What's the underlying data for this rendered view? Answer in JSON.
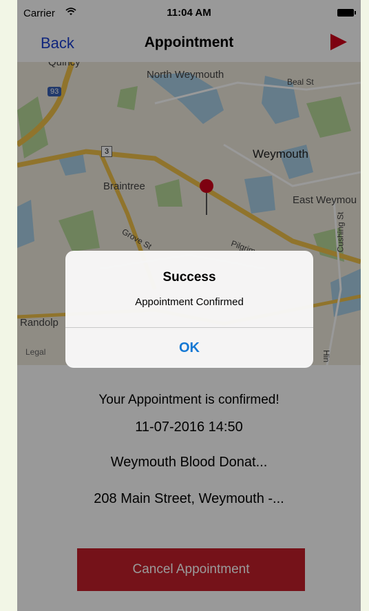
{
  "status_bar": {
    "carrier": "Carrier",
    "time": "11:04 AM"
  },
  "nav": {
    "back_label": "Back",
    "title": "Appointment"
  },
  "map": {
    "labels": {
      "quincy": "Quincy",
      "north_weymouth": "North Weymouth",
      "beal_st": "Beal St",
      "route_93": "93",
      "route_3": "3",
      "weymouth": "Weymouth",
      "braintree": "Braintree",
      "east_weymouth": "East Weymou",
      "grove_st": "Grove St",
      "pilgrim": "Pilgrim",
      "cushing_st": "Cushing St",
      "randolph": "Randolp",
      "legal": "Legal",
      "hingham": "Hin"
    }
  },
  "content": {
    "confirmation": "Your Appointment is confirmed!",
    "datetime": "11-07-2016 14:50",
    "location_name": "Weymouth Blood Donat...",
    "address": "208 Main Street, Weymouth -...",
    "cancel_label": "Cancel Appointment"
  },
  "alert": {
    "title": "Success",
    "message": "Appointment Confirmed",
    "ok_label": "OK"
  },
  "colors": {
    "accent_red": "#c41e2b",
    "nav_blue": "#1a3fd0",
    "alert_blue": "#1478d4"
  }
}
